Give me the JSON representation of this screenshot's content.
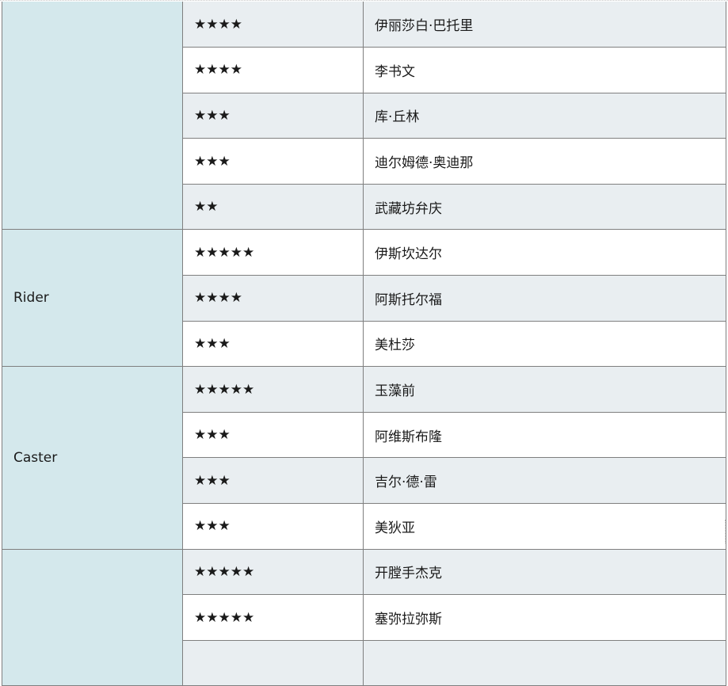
{
  "groups": [
    {
      "class_label": "",
      "rows": [
        {
          "rarity": "★★★★",
          "name": "伊丽莎白·巴托里"
        },
        {
          "rarity": "★★★★",
          "name": "李书文"
        },
        {
          "rarity": "★★★",
          "name": "库·丘林"
        },
        {
          "rarity": "★★★",
          "name": "迪尔姆德·奥迪那"
        },
        {
          "rarity": "★★",
          "name": "武藏坊弁庆"
        }
      ]
    },
    {
      "class_label": "Rider",
      "rows": [
        {
          "rarity": "★★★★★",
          "name": "伊斯坎达尔"
        },
        {
          "rarity": "★★★★",
          "name": "阿斯托尔福"
        },
        {
          "rarity": "★★★",
          "name": "美杜莎"
        }
      ]
    },
    {
      "class_label": "Caster",
      "rows": [
        {
          "rarity": "★★★★★",
          "name": "玉藻前"
        },
        {
          "rarity": "★★★",
          "name": "阿维斯布隆"
        },
        {
          "rarity": "★★★",
          "name": "吉尔·德·雷"
        },
        {
          "rarity": "★★★",
          "name": "美狄亚"
        }
      ]
    },
    {
      "class_label": "",
      "rows": [
        {
          "rarity": "★★★★★",
          "name": "开膛手杰克"
        },
        {
          "rarity": "★★★★★",
          "name": "塞弥拉弥斯"
        },
        {
          "rarity": "",
          "name": ""
        }
      ]
    }
  ],
  "colors": {
    "star": "#f7c600",
    "class_cell_bg": "#d4e8ec",
    "shaded_row_bg": "#e9eef1",
    "border": "#7f7f7f"
  }
}
